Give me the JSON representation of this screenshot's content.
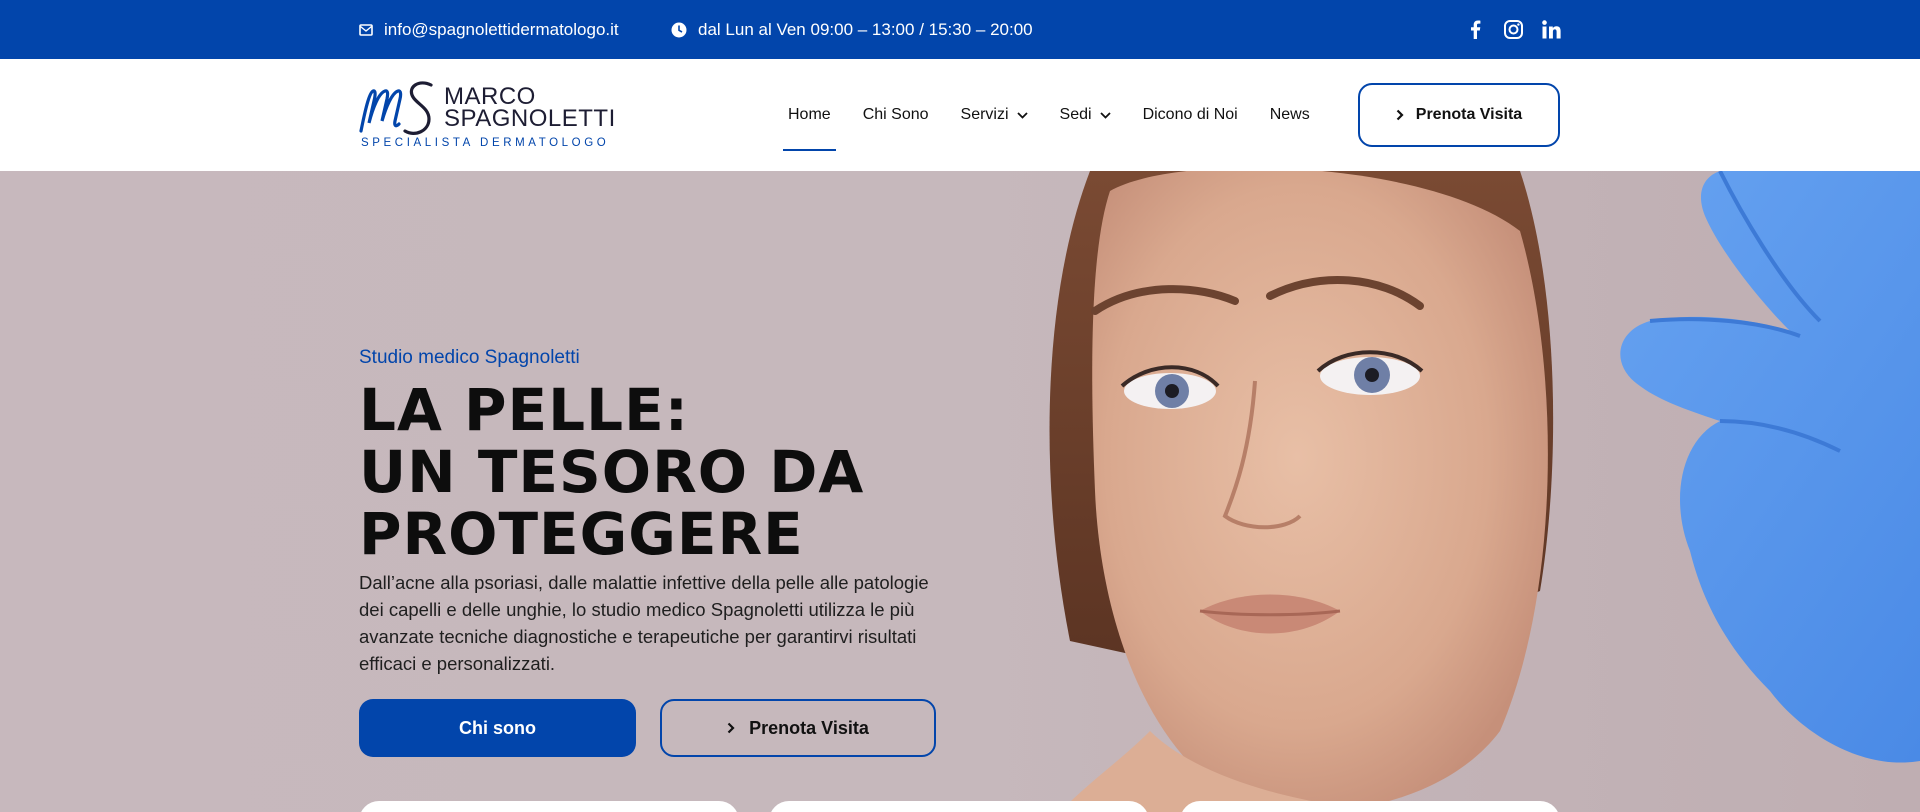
{
  "topbar": {
    "email": "info@spagnolettidermatologo.it",
    "hours": "dal Lun al Ven 09:00 – 13:00 / 15:30 – 20:00",
    "social": [
      "facebook-icon",
      "instagram-icon",
      "linkedin-icon"
    ],
    "background": "#0245ab"
  },
  "logo": {
    "line1": "MARCO",
    "line2": "SPAGNOLETTI",
    "subtitle": "SPECIALISTA DERMATOLOGO"
  },
  "nav": {
    "items": [
      {
        "label": "Home",
        "active": true
      },
      {
        "label": "Chi Sono"
      },
      {
        "label": "Servizi",
        "dropdown": true
      },
      {
        "label": "Sedi",
        "dropdown": true
      },
      {
        "label": "Dicono di Noi"
      },
      {
        "label": "News"
      }
    ]
  },
  "header": {
    "cta_label": "Prenota Visita"
  },
  "hero": {
    "kicker": "Studio medico Spagnoletti",
    "title_line1": "LA PELLE:",
    "title_line2": "UN TESORO DA",
    "title_line3": "PROTEGGERE",
    "description": "Dall’acne alla psoriasi, dalle malattie infettive della pelle alle patologie dei capelli e delle unghie, lo studio medico Spagnoletti utilizza le più avanzate tecniche diagnostiche e terapeutiche per garantirvi risultati efficaci e personalizzati.",
    "primary_button": "Chi sono",
    "secondary_button": "Prenota Visita"
  },
  "colors": {
    "accent": "#0245ab",
    "hero_bg": "#c7b8bd",
    "glove": "#5b9bef"
  }
}
